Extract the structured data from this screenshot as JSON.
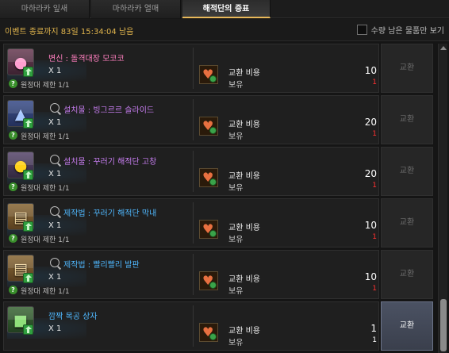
{
  "tabs": [
    {
      "label": "마하라카 잎새"
    },
    {
      "label": "마하라카 열매"
    },
    {
      "label": "해적단의 증표"
    }
  ],
  "event_time": "이벤트 종료까지 83일 15:34:04 남음",
  "filter": {
    "label": "수량 남은 물품만 보기",
    "checked": false
  },
  "labels": {
    "cost": "교환 비용",
    "owned": "보유",
    "exchange": "교환"
  },
  "items": [
    {
      "name": "변신 : 돌격대장 모코코",
      "quantity": "X 1",
      "limit": "원정대 제한 1/1",
      "cost": "10",
      "owned": "1",
      "exchange_enabled": false,
      "icon": "mokoko-icon",
      "name_color": "#ff7fbf",
      "has_search": false
    },
    {
      "name": "설치물 : 빙그르르 슬라이드",
      "quantity": "X 1",
      "limit": "원정대 제한 1/1",
      "cost": "20",
      "owned": "1",
      "exchange_enabled": false,
      "icon": "slide-icon",
      "name_color": "#c87ef2",
      "has_search": true
    },
    {
      "name": "설치물 : 꾸러기 해적단 고창",
      "quantity": "X 1",
      "limit": "원정대 제한 1/1",
      "cost": "20",
      "owned": "1",
      "exchange_enabled": false,
      "icon": "duck-icon",
      "name_color": "#c87ef2",
      "has_search": true
    },
    {
      "name": "제작법 : 꾸러기 해적단 막내",
      "quantity": "X 1",
      "limit": "원정대 제한 1/1",
      "cost": "10",
      "owned": "1",
      "exchange_enabled": false,
      "icon": "recipe-icon",
      "name_color": "#4fb8ff",
      "has_search": true
    },
    {
      "name": "제작법 : 빨리빨리 발판",
      "quantity": "X 1",
      "limit": "원정대 제한 1/1",
      "cost": "10",
      "owned": "1",
      "exchange_enabled": false,
      "icon": "recipe-icon",
      "name_color": "#4fb8ff",
      "has_search": true
    },
    {
      "name": "깜짝 목공 상자",
      "quantity": "X 1",
      "limit": "",
      "cost": "1",
      "owned": "1",
      "exchange_enabled": true,
      "icon": "wood-box-icon",
      "name_color": "#4fb8ff",
      "has_search": false
    }
  ]
}
